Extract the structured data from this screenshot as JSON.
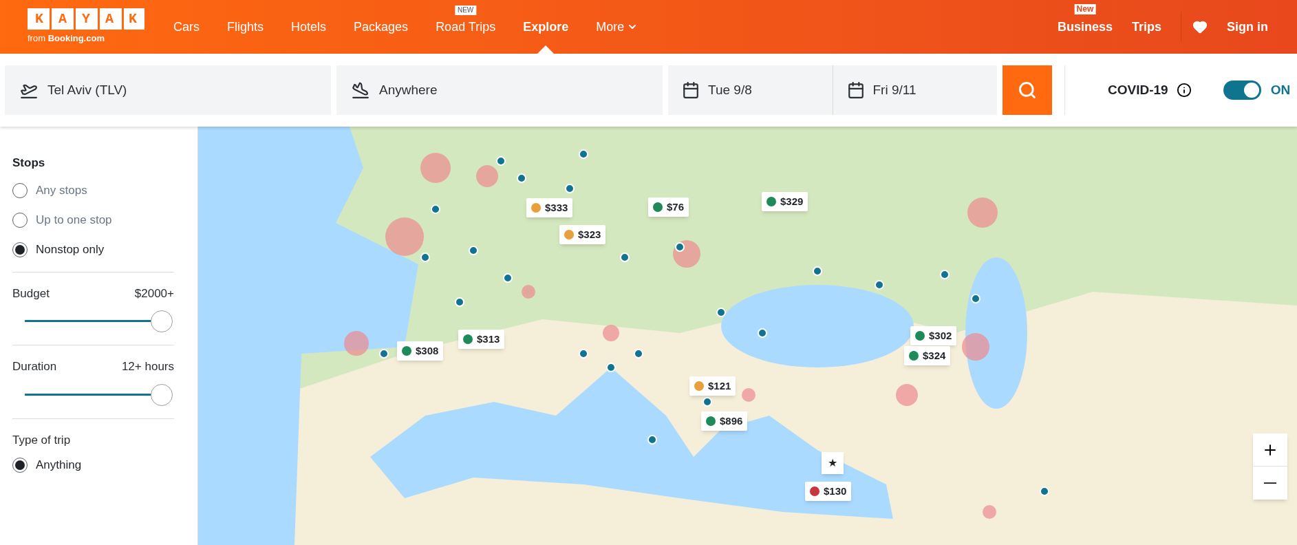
{
  "header": {
    "logo": {
      "wordmark": "KAYAK",
      "tagline": "from **Booking.com**"
    },
    "nav": [
      {
        "label": "Cars",
        "selected": false
      },
      {
        "label": "Flights",
        "selected": false
      },
      {
        "label": "Hotels",
        "selected": false
      },
      {
        "label": "Packages",
        "selected": false
      },
      {
        "label": "Road Trips",
        "selected": false,
        "badge": "NEW"
      },
      {
        "label": "Explore",
        "selected": true
      },
      {
        "label": "More",
        "selected": false,
        "dropdown": true
      }
    ],
    "right": [
      {
        "label": "Business",
        "badge": "New"
      },
      {
        "label": "Trips"
      }
    ],
    "sign_in": "Sign in"
  },
  "search": {
    "origin": "Tel Aviv (TLV)",
    "destination": "Anywhere",
    "depart": "Tue 9/8",
    "return": "Fri 9/11"
  },
  "covid": {
    "label": "COVID-19",
    "on": true,
    "state_label": "ON"
  },
  "sidebar": {
    "stops": {
      "title": "Stops",
      "options": [
        {
          "label": "Any stops",
          "selected": false
        },
        {
          "label": "Up to one stop",
          "selected": false
        },
        {
          "label": "Nonstop only",
          "selected": true
        }
      ]
    },
    "sliders": [
      {
        "label": "Budget",
        "value": "$2000+",
        "level": 1
      },
      {
        "label": "Duration",
        "value": "12+ hours",
        "level": 1
      }
    ],
    "trip_type": {
      "title": "Type of trip",
      "options": [
        {
          "label": "Anything",
          "selected": true
        }
      ]
    }
  },
  "map": {
    "markers": [
      {
        "kind": "price",
        "price": "$333",
        "color": "#e8a03a"
      },
      {
        "kind": "price",
        "price": "$76",
        "color": "#1e8a5a"
      },
      {
        "kind": "price",
        "price": "$329",
        "color": "#1e8a5a"
      },
      {
        "kind": "price",
        "price": "$323",
        "color": "#e8a03a"
      },
      {
        "kind": "price",
        "price": "$313",
        "color": "#1e8a5a"
      },
      {
        "kind": "price",
        "price": "$308",
        "color": "#1e8a5a"
      },
      {
        "kind": "price",
        "price": "$302",
        "color": "#1e8a5a"
      },
      {
        "kind": "price",
        "price": "$324",
        "color": "#1e8a5a"
      },
      {
        "kind": "price",
        "price": "$121",
        "color": "#e8a03a"
      },
      {
        "kind": "price",
        "price": "$896",
        "color": "#1e8a5a"
      },
      {
        "kind": "price",
        "price": "$130",
        "color": "#c9343f"
      },
      {
        "kind": "star",
        "symbol": "★"
      }
    ]
  }
}
